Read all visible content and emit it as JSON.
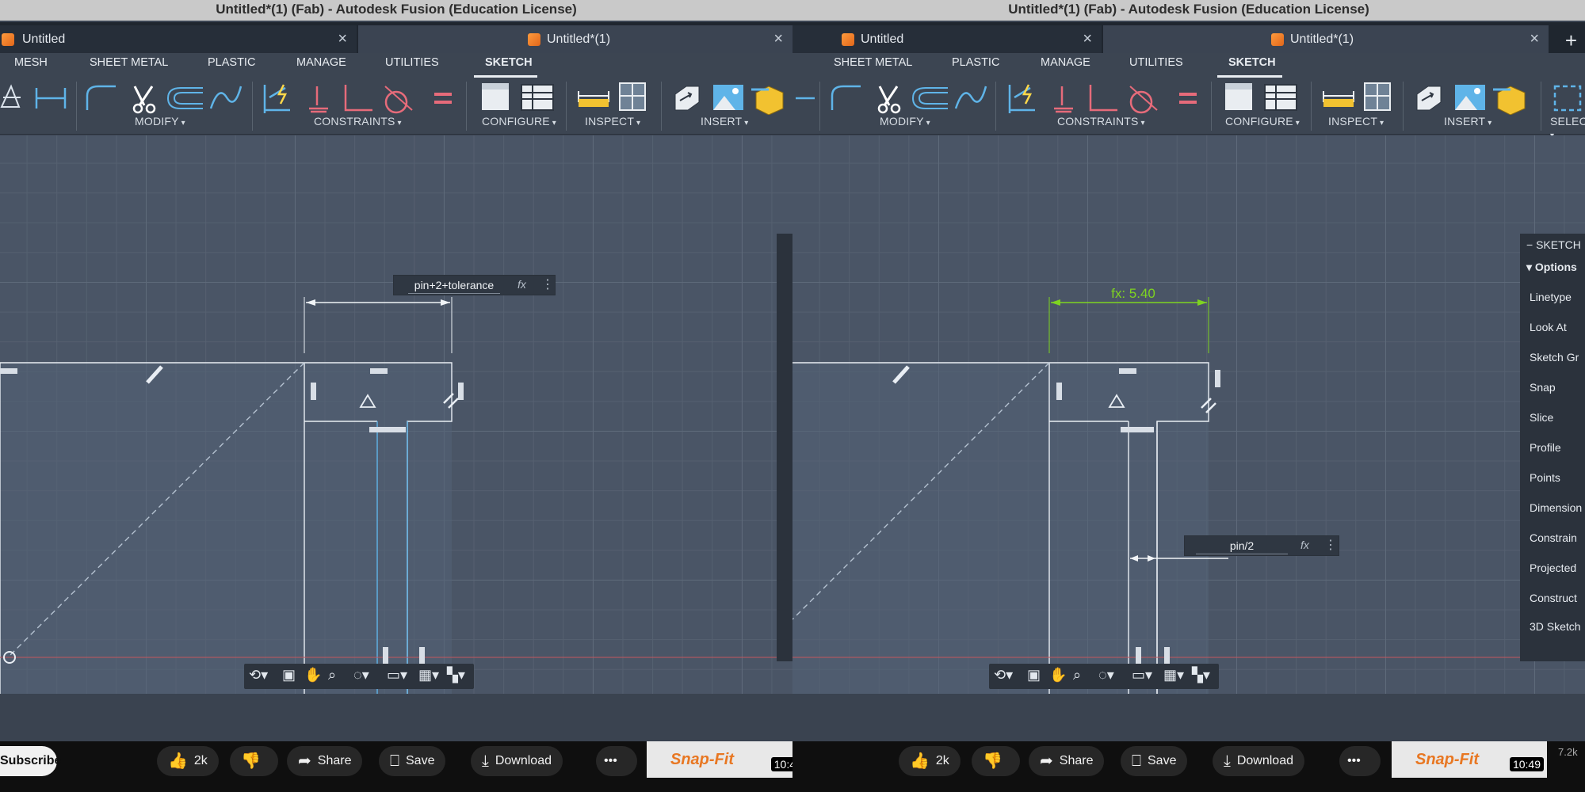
{
  "window_title": "Untitled*(1) (Fab) - Autodesk Fusion (Education License)",
  "tabs": [
    {
      "label": "Untitled",
      "close": "×"
    },
    {
      "label": "Untitled*(1)",
      "close": "×"
    }
  ],
  "new_tab": "+",
  "left": {
    "ribbon_tabs": [
      "MESH",
      "SHEET METAL",
      "PLASTIC",
      "MANAGE",
      "UTILITIES",
      "SKETCH"
    ],
    "groups": [
      "MODIFY",
      "CONSTRAINTS",
      "CONFIGURE",
      "INSPECT",
      "INSERT"
    ],
    "dimension_input": "pin+2+tolerance",
    "fx": "fx",
    "more": "⋮"
  },
  "right": {
    "ribbon_tabs": [
      "SHEET METAL",
      "PLASTIC",
      "MANAGE",
      "UTILITIES",
      "SKETCH"
    ],
    "groups": [
      "MODIFY",
      "CONSTRAINTS",
      "CONFIGURE",
      "INSPECT",
      "INSERT",
      "SELEC"
    ],
    "dimension_label": "fx: 5.40",
    "dimension_input": "pin/2",
    "fx": "fx",
    "more": "⋮",
    "sketch_palette": {
      "header": "SKETCH",
      "section": "Options",
      "items": [
        "Linetype",
        "Look At",
        "Sketch Gr",
        "Snap",
        "Slice",
        "Profile",
        "Points",
        "Dimension",
        "Constrain",
        "Projected",
        "Construct",
        "3D Sketch"
      ]
    }
  },
  "navbar_icons": [
    "orbit-icon",
    "capture-icon",
    "pan-icon",
    "zoom-icon",
    "fit-icon",
    "display-icon",
    "grid-icon",
    "viewports-icon"
  ],
  "youtube": {
    "subscribe": "Subscribe",
    "likes": "2k",
    "share": "Share",
    "save": "Save",
    "download": "Download",
    "more": "•••",
    "thumbnail_title": "Snap-Fit",
    "duration_left": "10:4",
    "duration_right": "10:49",
    "views": "7.2k"
  },
  "colors": {
    "canvas": "#4a5566",
    "sketch_line": "#e9eef4",
    "constraint_dim": "#7ed321",
    "selected_line": "#5fb4e8"
  }
}
